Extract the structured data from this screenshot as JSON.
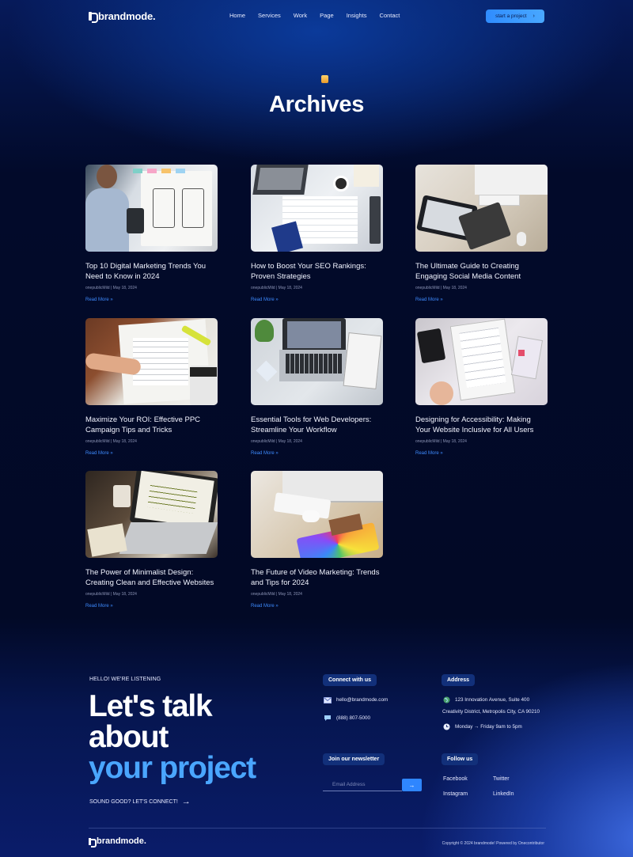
{
  "header": {
    "logo": "brandmode.",
    "nav": [
      "Home",
      "Services",
      "Work",
      "Page",
      "Insights",
      "Contact"
    ],
    "cta_label": "start a project",
    "cta_icon": "chevron-right-icon"
  },
  "hero": {
    "title": "Archives",
    "icon": "folder-icon",
    "icon_color": "#f2b84b"
  },
  "posts": [
    {
      "title": "Top 10 Digital Marketing Trends You Need to Know in 2024",
      "meta": "onepublicMild | May 18, 2024",
      "read_more": "Read More »"
    },
    {
      "title": "How to Boost Your SEO Rankings: Proven Strategies",
      "meta": "onepublicMild | May 18, 2024",
      "read_more": "Read More »"
    },
    {
      "title": "The Ultimate Guide to Creating Engaging Social Media Content",
      "meta": "onepublicMild | May 18, 2024",
      "read_more": "Read More »"
    },
    {
      "title": "Maximize Your ROI: Effective PPC Campaign Tips and Tricks",
      "meta": "onepublicMild | May 18, 2024",
      "read_more": "Read More »"
    },
    {
      "title": "Essential Tools for Web Developers: Streamline Your Workflow",
      "meta": "onepublicMild | May 18, 2024",
      "read_more": "Read More »"
    },
    {
      "title": "Designing for Accessibility: Making Your Website Inclusive for All Users",
      "meta": "onepublicMild | May 18, 2024",
      "read_more": "Read More »"
    },
    {
      "title": "The Power of Minimalist Design: Creating Clean and Effective Websites",
      "meta": "onepublicMild | May 18, 2024",
      "read_more": "Read More »"
    },
    {
      "title": "The Future of Video Marketing: Trends and Tips for 2024",
      "meta": "onepublicMild | May 18, 2024",
      "read_more": "Read More »"
    }
  ],
  "footer": {
    "hello": "HELLO! WE'RE LISTENING",
    "big_line1": "Let's talk",
    "big_line2": "about",
    "big_line3": "your project",
    "sound_good": "SOUND GOOD? LET'S CONNECT!",
    "connect_heading": "Connect with us",
    "email": "hello@brandmode.com",
    "phone": "(888) 807-5000",
    "address_heading": "Address",
    "address_line1": "123 Innovation Avenue, Suite 400",
    "address_line2": "Creativity District, Metropolis City, CA 90210",
    "hours": "Monday → Friday 9am to 5pm",
    "newsletter_heading": "Join our newsletter",
    "newsletter_placeholder": "Email Address",
    "follow_heading": "Follow us",
    "social": [
      "Facebook",
      "Twitter",
      "Instagram",
      "LinkedIn"
    ],
    "logo": "brandmode.",
    "copyright": "Copyright © 2024 brandmode! Powered by Onecontributor"
  },
  "colors": {
    "accent": "#2f86ff",
    "link": "#3d8bff",
    "highlight_text": "#4aa6ff",
    "pill_bg": "#12307a"
  }
}
